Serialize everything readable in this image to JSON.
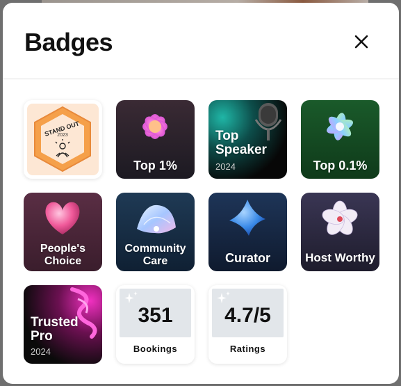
{
  "modal": {
    "title": "Badges",
    "close_icon": "close-icon"
  },
  "badges": [
    {
      "id": "stand-out",
      "seal_text": "STAND OUT",
      "year": "2023",
      "icon": "person-icon"
    },
    {
      "id": "top-1",
      "label": "Top 1%",
      "icon": "flower-icon"
    },
    {
      "id": "top-speaker",
      "label_line1": "Top",
      "label_line2": "Speaker",
      "year": "2024",
      "icon": "microphone-icon"
    },
    {
      "id": "top-0-1",
      "label": "Top 0.1%",
      "icon": "flower-icon"
    },
    {
      "id": "peoples-choice",
      "label_line1": "People's",
      "label_line2": "Choice",
      "icon": "heart-icon"
    },
    {
      "id": "community-care",
      "label_line1": "Community",
      "label_line2": "Care",
      "icon": "shell-icon"
    },
    {
      "id": "curator",
      "label": "Curator",
      "icon": "star-icon"
    },
    {
      "id": "host-worthy",
      "label": "Host Worthy",
      "icon": "flower-icon"
    },
    {
      "id": "trusted-pro",
      "label_line1": "Trusted",
      "label_line2": "Pro",
      "year": "2024",
      "icon": "ribbon-icon"
    }
  ],
  "stats": [
    {
      "value": "351",
      "label": "Bookings",
      "icon": "sparkle-icon"
    },
    {
      "value": "4.7/5",
      "label": "Ratings",
      "icon": "sparkle-icon"
    }
  ],
  "colors": {
    "stand_out_hex": "#f39a3b",
    "top_speaker_accent": "#1fb6a6",
    "top_0_1_bg": "#1e5a2c",
    "stat_box": "#e2e6ea"
  }
}
